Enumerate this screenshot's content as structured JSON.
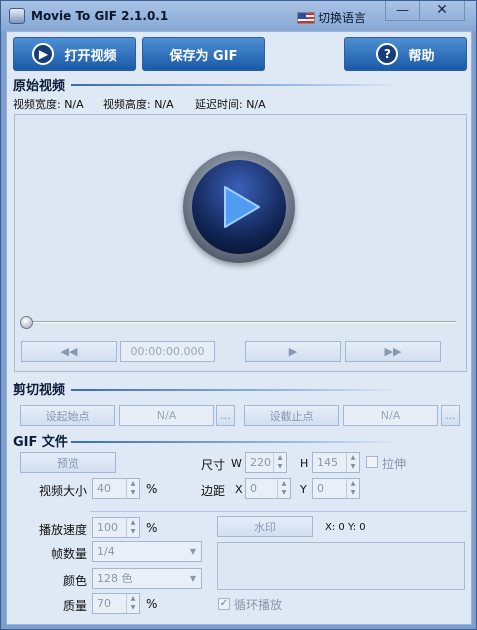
{
  "window": {
    "title": "Movie To GIF 2.1.0.1",
    "language_label": "切换语言",
    "minimize_glyph": "—",
    "close_glyph": "✕"
  },
  "toolbar": {
    "open_label": "打开视频",
    "save_label": "保存为 GIF",
    "help_label": "帮助",
    "help_glyph": "?"
  },
  "source": {
    "section_title": "原始视频",
    "width_label": "视频宽度: N/A",
    "height_label": "视频高度: N/A",
    "delay_label": "延迟时间: N/A"
  },
  "player": {
    "time": "00:00:00.000",
    "rewind_glyph": "◀◀",
    "play_glyph": "▶",
    "forward_glyph": "▶▶",
    "progress": 0
  },
  "cut": {
    "section_title": "剪切视频",
    "start_button": "设起始点",
    "start_value": "N/A",
    "end_button": "设截止点",
    "end_value": "N/A",
    "more_glyph": "..."
  },
  "gif": {
    "section_title": "GIF 文件",
    "preview_button": "预览",
    "size_label": "尺寸",
    "w_label": "W",
    "w_value": "220",
    "h_label": "H",
    "h_value": "145",
    "stretch_label": "拉伸",
    "stretch_checked": false,
    "video_size_label": "视频大小",
    "video_size_value": "40",
    "percent": "%",
    "margin_label": "边距",
    "x_label": "X",
    "x_value": "0",
    "y_label": "Y",
    "y_value": "0",
    "speed_label": "播放速度",
    "speed_value": "100",
    "frames_label": "帧数量",
    "frames_value": "1/4",
    "color_label": "颜色",
    "color_value": "128 色",
    "quality_label": "质量",
    "quality_value": "70",
    "watermark_button": "水印",
    "watermark_coords": "X: 0  Y: 0",
    "loop_label": "循环播放",
    "loop_checked": true
  }
}
